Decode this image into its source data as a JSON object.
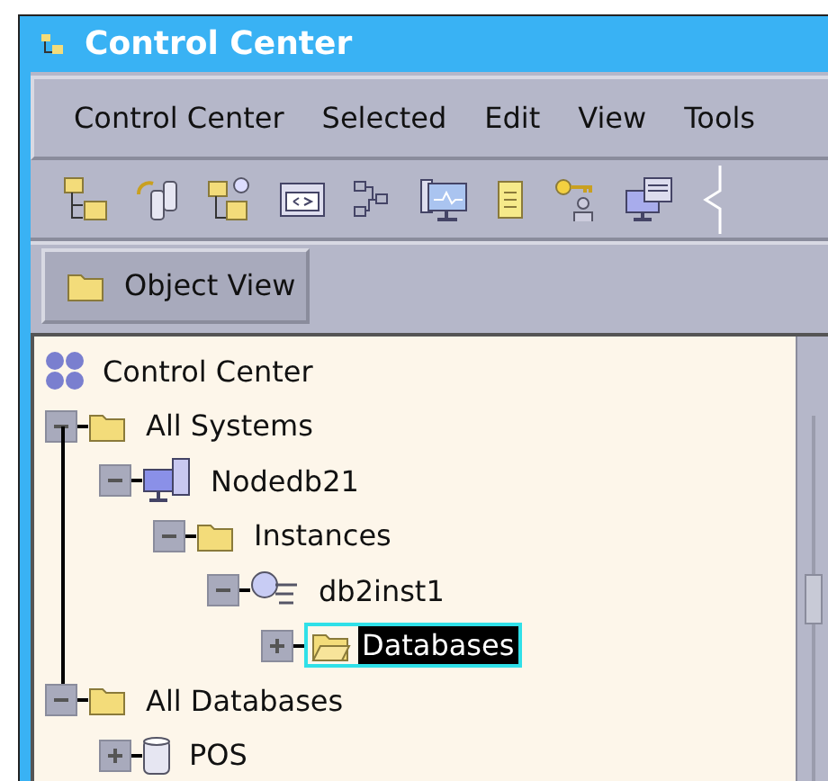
{
  "window": {
    "title": "Control Center"
  },
  "menu": [
    "Control Center",
    "Selected",
    "Edit",
    "View",
    "Tools"
  ],
  "tabs": [
    {
      "label": "Object View",
      "selected": true
    }
  ],
  "tree": [
    {
      "label": "Control Center",
      "kind": "root",
      "selected": false,
      "children": [
        {
          "label": "All Systems",
          "kind": "folder",
          "expanded": true,
          "selected": false,
          "children": [
            {
              "label": "Nodedb21",
              "kind": "computer",
              "expanded": true,
              "selected": false,
              "children": [
                {
                  "label": "Instances",
                  "kind": "folder",
                  "expanded": true,
                  "selected": false,
                  "children": [
                    {
                      "label": "db2inst1",
                      "kind": "instance",
                      "expanded": true,
                      "selected": false,
                      "children": [
                        {
                          "label": "Databases",
                          "kind": "open-folder",
                          "expanded": false,
                          "selected": true
                        }
                      ]
                    }
                  ]
                }
              ]
            }
          ]
        },
        {
          "label": "All Databases",
          "kind": "folder",
          "expanded": true,
          "selected": false,
          "children": [
            {
              "label": "POS",
              "kind": "database",
              "expanded": false,
              "selected": false
            }
          ]
        }
      ]
    }
  ]
}
